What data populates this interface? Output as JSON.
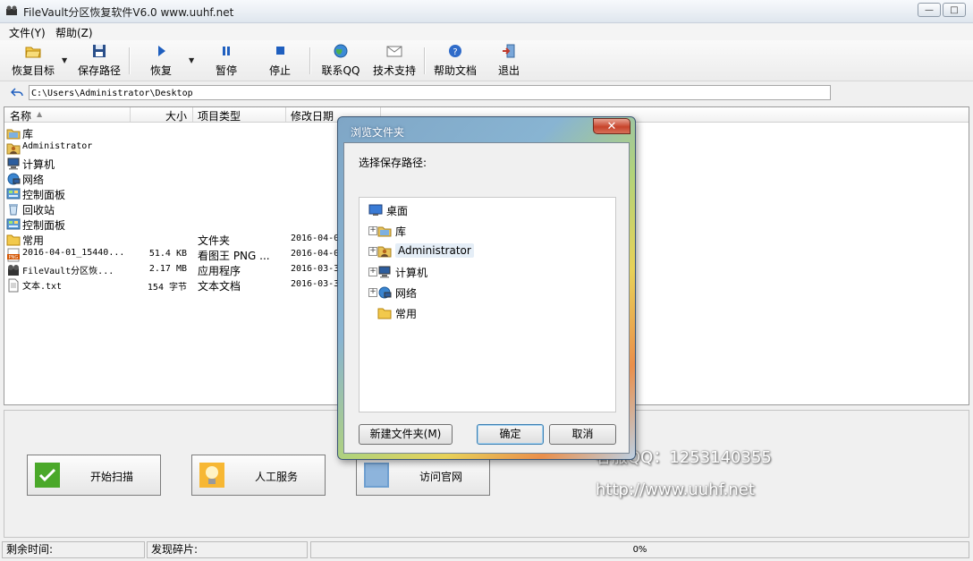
{
  "window": {
    "title": "FileVault分区恢复软件V6.0 www.uuhf.net"
  },
  "window_controls": {
    "minimize": "—",
    "maximize": "□",
    "close": "✕"
  },
  "menu": {
    "items": [
      "文件(Y)",
      "帮助(Z)"
    ]
  },
  "toolbar": {
    "restore_target": "恢复目标",
    "save_path": "保存路径",
    "restore": "恢复",
    "pause": "暂停",
    "stop": "停止",
    "contact_qq": "联系QQ",
    "tech_support": "技术支持",
    "help_doc": "帮助文档",
    "exit": "退出"
  },
  "address": {
    "path": "C:\\Users\\Administrator\\Desktop"
  },
  "filelist": {
    "headers": {
      "name": "名称",
      "size": "大小",
      "type": "项目类型",
      "modified": "修改日期"
    },
    "rows": [
      {
        "name": "库",
        "size": "",
        "type": "",
        "modified": "",
        "icon": "library-icon"
      },
      {
        "name": "Administrator",
        "size": "",
        "type": "",
        "modified": "",
        "icon": "user-folder-icon"
      },
      {
        "name": "计算机",
        "size": "",
        "type": "",
        "modified": "",
        "icon": "computer-icon"
      },
      {
        "name": "网络",
        "size": "",
        "type": "",
        "modified": "",
        "icon": "network-icon"
      },
      {
        "name": "控制面板",
        "size": "",
        "type": "",
        "modified": "",
        "icon": "control-panel-icon"
      },
      {
        "name": "回收站",
        "size": "",
        "type": "",
        "modified": "",
        "icon": "recycle-bin-icon"
      },
      {
        "name": "控制面板",
        "size": "",
        "type": "",
        "modified": "",
        "icon": "control-panel-icon"
      },
      {
        "name": "常用",
        "size": "",
        "type": "文件夹",
        "modified": "2016-04-0",
        "icon": "folder-icon"
      },
      {
        "name": "2016-04-01_15440...",
        "size": "51.4 KB",
        "type": "看图王 PNG ...",
        "modified": "2016-04-0",
        "icon": "png-file-icon"
      },
      {
        "name": "FileVault分区恢...",
        "size": "2.17 MB",
        "type": "应用程序",
        "modified": "2016-03-3",
        "icon": "app-icon"
      },
      {
        "name": "文本.txt",
        "size": "154 字节",
        "type": "文本文档",
        "modified": "2016-03-3",
        "icon": "text-file-icon"
      }
    ]
  },
  "bottom": {
    "start_scan": "开始扫描",
    "manual_service": "人工服务",
    "visit_site": "访问官网",
    "watermark_qq": "客服QQ：1253140355",
    "watermark_url": "http://www.uuhf.net"
  },
  "status": {
    "remaining_label": "剩余时间:",
    "fragments_label": "发现碎片:",
    "progress_text": "0%",
    "progress": 0
  },
  "dialog": {
    "title": "浏览文件夹",
    "close": "✕",
    "prompt": "选择保存路径:",
    "tree": [
      {
        "label": "桌面",
        "expander": "",
        "icon": "desktop-icon"
      },
      {
        "label": "库",
        "expander": "+",
        "icon": "library-icon"
      },
      {
        "label": "Administrator",
        "expander": "+",
        "icon": "user-folder-icon",
        "selected": true
      },
      {
        "label": "计算机",
        "expander": "+",
        "icon": "computer-icon"
      },
      {
        "label": "网络",
        "expander": "+",
        "icon": "network-icon"
      },
      {
        "label": "常用",
        "expander": "",
        "icon": "folder-icon"
      }
    ],
    "new_folder": "新建文件夹(M)",
    "ok": "确定",
    "cancel": "取消"
  },
  "colors": {
    "selection": "#e5eef7",
    "dialog_accent": "#3c5673",
    "scan_green": "#4aa829",
    "service_orange": "#f0a020"
  }
}
